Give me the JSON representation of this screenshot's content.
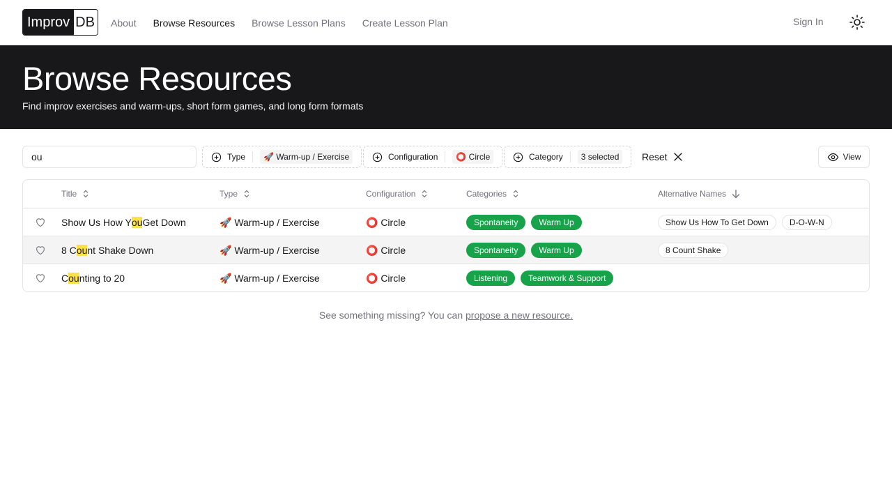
{
  "brand": {
    "part1": "Improv",
    "part2": "DB"
  },
  "nav": {
    "items": [
      {
        "label": "About",
        "active": false
      },
      {
        "label": "Browse Resources",
        "active": true
      },
      {
        "label": "Browse Lesson Plans",
        "active": false
      },
      {
        "label": "Create Lesson Plan",
        "active": false
      }
    ],
    "sign_in": "Sign In",
    "theme_icon": "sun-icon"
  },
  "hero": {
    "title": "Browse Resources",
    "subtitle": "Find improv exercises and warm-ups, short form games, and long form formats"
  },
  "toolbar": {
    "search_value": "ou",
    "filters": [
      {
        "label": "Type",
        "selected": "🚀 Warm-up / Exercise"
      },
      {
        "label": "Configuration",
        "selected": "⭕ Circle"
      },
      {
        "label": "Category",
        "selected": "3 selected"
      }
    ],
    "reset_label": "Reset",
    "view_label": "View"
  },
  "table": {
    "columns": [
      "Title",
      "Type",
      "Configuration",
      "Categories",
      "Alternative Names"
    ],
    "rows": [
      {
        "title_parts": [
          "Show Us How Y",
          "ou",
          " Get Down"
        ],
        "type": "🚀 Warm-up / Exercise",
        "configuration": "⭕ Circle",
        "categories": [
          "Spontaneity",
          "Warm Up"
        ],
        "alt_names": [
          "Show Us How To Get Down",
          "D-O-W-N"
        ]
      },
      {
        "title_parts": [
          "8 C",
          "ou",
          "nt Shake Down"
        ],
        "type": "🚀 Warm-up / Exercise",
        "configuration": "⭕ Circle",
        "categories": [
          "Spontaneity",
          "Warm Up"
        ],
        "alt_names": [
          "8 Count Shake"
        ]
      },
      {
        "title_parts": [
          "C",
          "ou",
          "nting to 20"
        ],
        "type": "🚀 Warm-up / Exercise",
        "configuration": "⭕ Circle",
        "categories": [
          "Listening",
          "Teamwork & Support"
        ],
        "alt_names": []
      }
    ]
  },
  "footer": {
    "text": "See something missing? You can ",
    "link": "propose a new resource."
  },
  "colors": {
    "header_bg": "#18181b",
    "category_badge": "#16a34a",
    "highlight": "#fde047"
  }
}
